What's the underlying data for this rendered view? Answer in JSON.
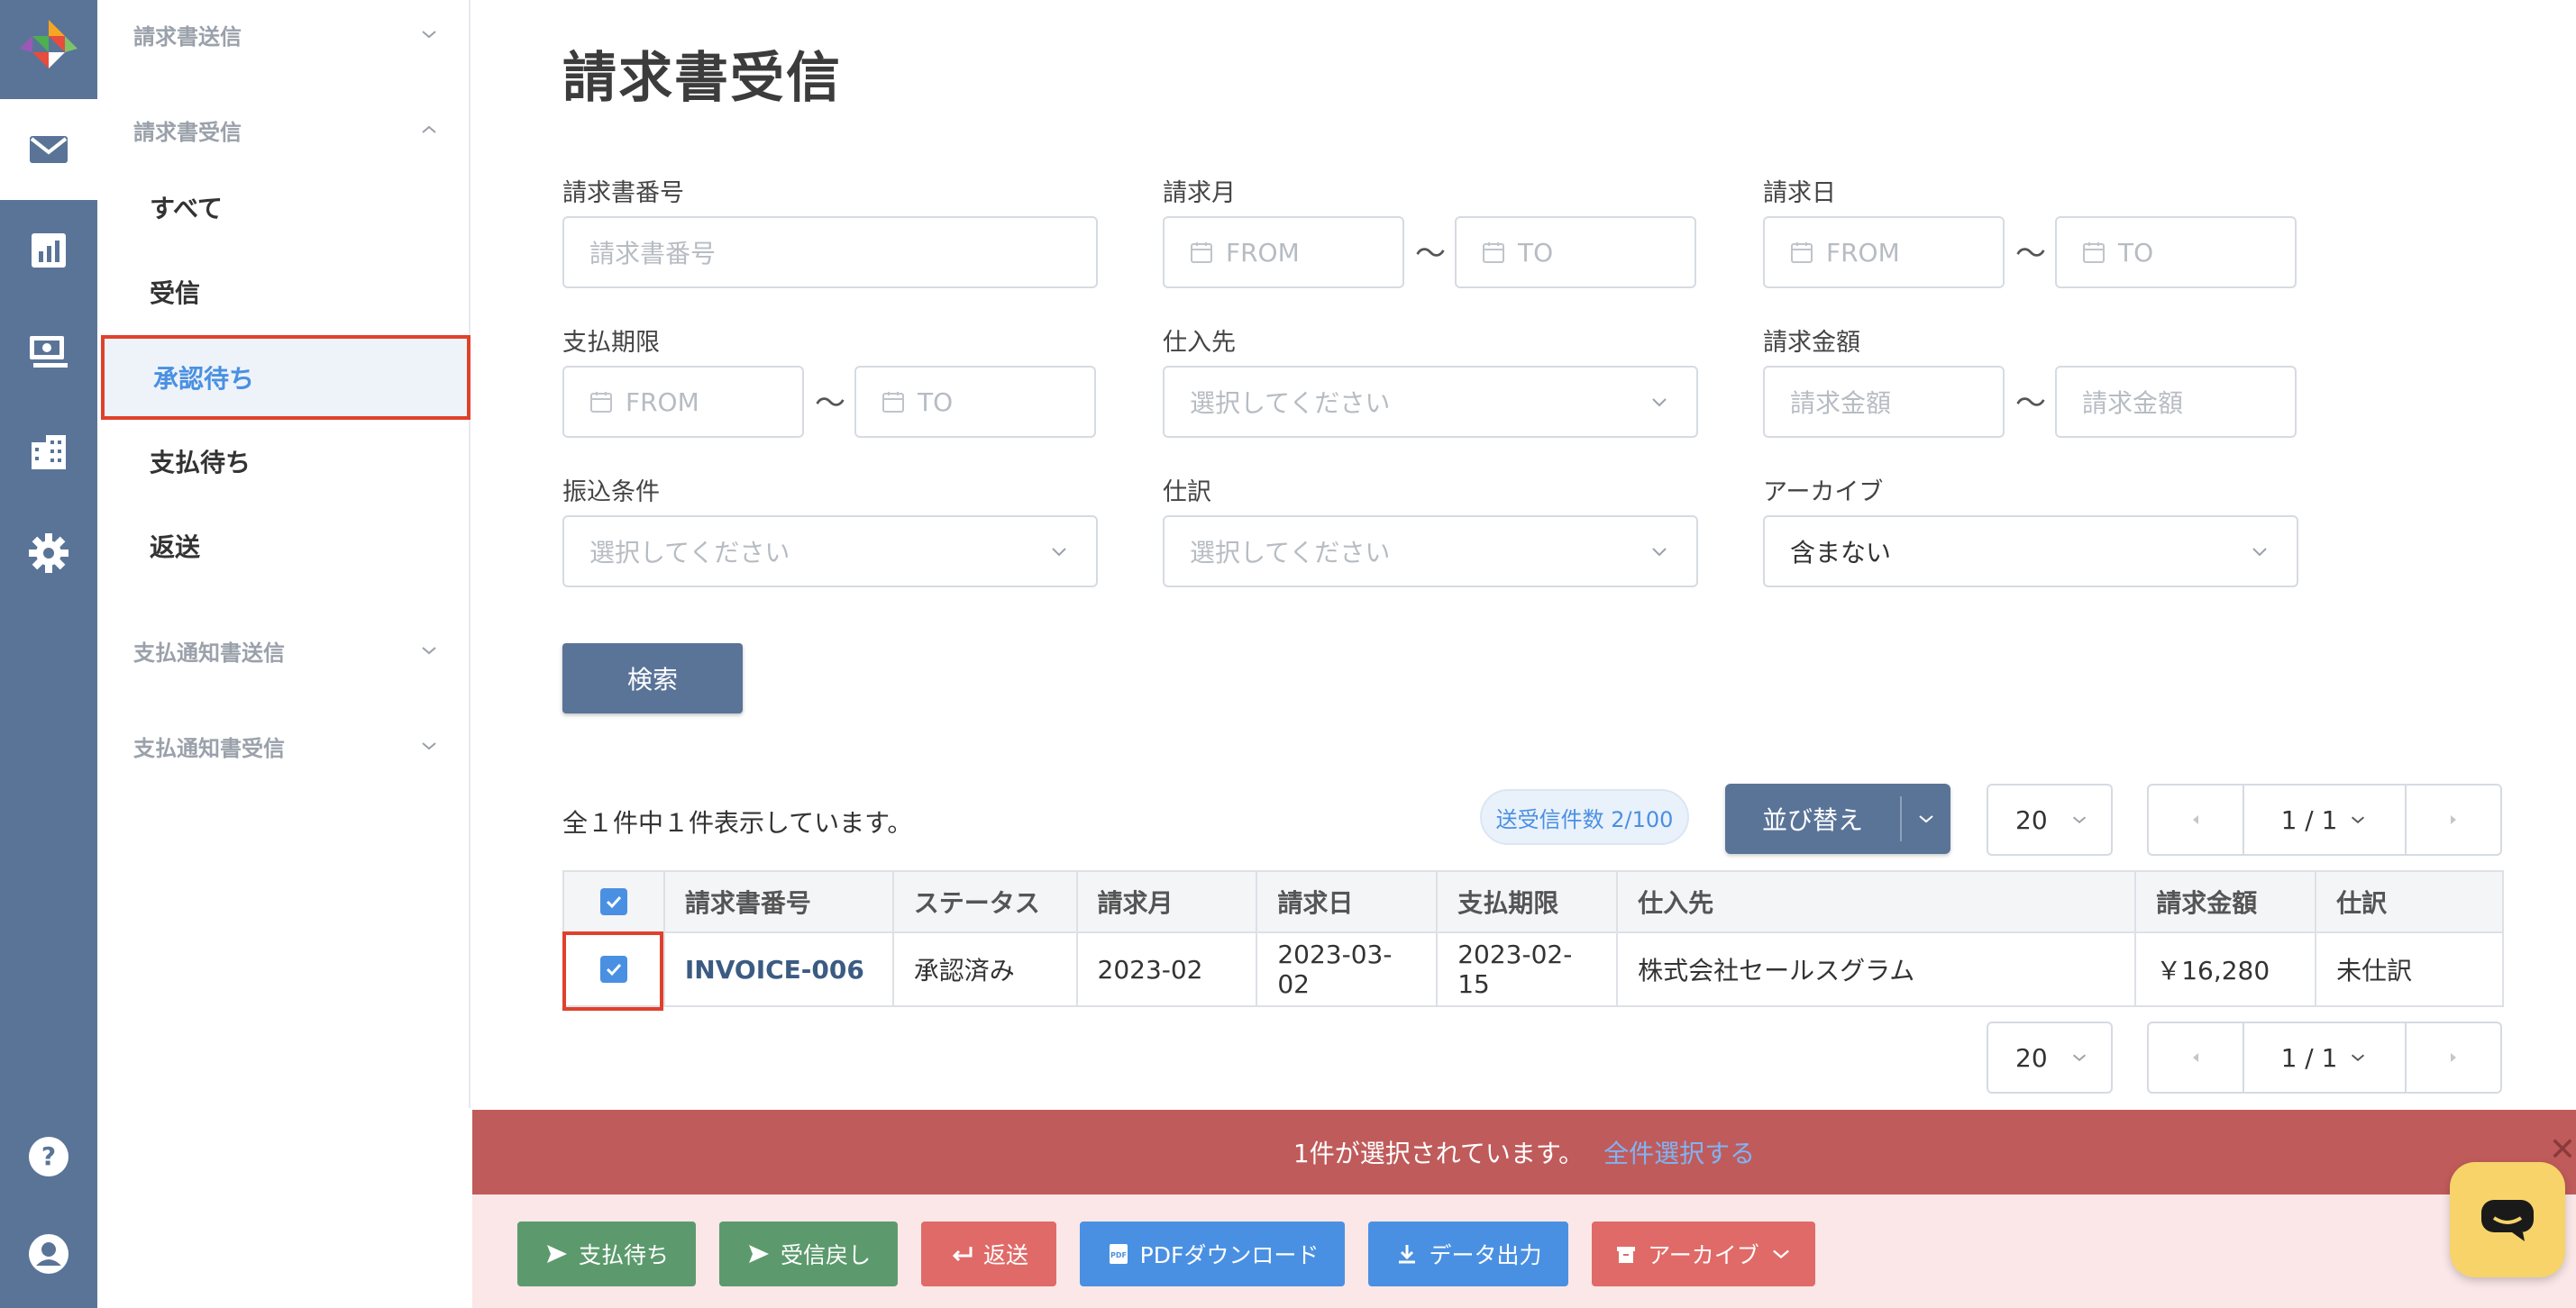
{
  "rail": {
    "items": [
      {
        "icon": "mail-icon"
      },
      {
        "icon": "chart-icon"
      },
      {
        "icon": "money-icon"
      },
      {
        "icon": "building-icon"
      },
      {
        "icon": "gear-icon"
      },
      {
        "icon": "help-icon"
      },
      {
        "icon": "user-icon"
      }
    ]
  },
  "sidenav": {
    "group_send": "請求書送信",
    "group_receive": "請求書受信",
    "items": [
      "すべて",
      "受信",
      "承認待ち",
      "支払待ち",
      "返送"
    ],
    "active_item": "承認待ち",
    "group_notice_send": "支払通知書送信",
    "group_notice_receive": "支払通知書受信"
  },
  "page": {
    "title": "請求書受信"
  },
  "filters": {
    "invoice_no": {
      "label": "請求書番号",
      "placeholder": "請求書番号"
    },
    "month": {
      "label": "請求月",
      "from": "FROM",
      "to": "TO"
    },
    "date": {
      "label": "請求日",
      "from": "FROM",
      "to": "TO"
    },
    "due": {
      "label": "支払期限",
      "from": "FROM",
      "to": "TO"
    },
    "supplier": {
      "label": "仕入先",
      "placeholder": "選択してください"
    },
    "amount": {
      "label": "請求金額",
      "from_placeholder": "請求金額",
      "to_placeholder": "請求金額"
    },
    "transfer": {
      "label": "振込条件",
      "placeholder": "選択してください"
    },
    "journal": {
      "label": "仕訳",
      "placeholder": "選択してください"
    },
    "archive": {
      "label": "アーカイブ",
      "value": "含まない"
    },
    "tilde": "〜",
    "search_button": "検索"
  },
  "results": {
    "count_text": "全１件中１件表示しています。",
    "quota": "送受信件数 2/100",
    "sort_label": "並び替え",
    "per_page": "20",
    "page": "1 / 1"
  },
  "table": {
    "headers": [
      "請求書番号",
      "ステータス",
      "請求月",
      "請求日",
      "支払期限",
      "仕入先",
      "請求金額",
      "仕訳"
    ],
    "rows": [
      {
        "invoice_no": "INVOICE-006",
        "status": "承認済み",
        "month": "2023-02",
        "date": "2023-03-02",
        "due": "2023-02-15",
        "supplier": "株式会社セールスグラム",
        "amount": "￥16,280",
        "journal": "未仕訳"
      }
    ]
  },
  "selection": {
    "text": "1件が選択されています。",
    "select_all": "全件選択する",
    "close": "✕"
  },
  "actions": {
    "pay_wait": "支払待ち",
    "back_receive": "受信戻し",
    "return": "返送",
    "pdf": "PDFダウンロード",
    "export": "データ出力",
    "archive": "アーカイブ"
  },
  "colors": {
    "rail": "#5a7498",
    "accent": "#4a90e2",
    "highlight": "#e0412c",
    "selection_bar": "#c05b5b",
    "btn_green": "#5c9a6d",
    "btn_red": "#e06a67",
    "btn_blue": "#4a90e2"
  }
}
